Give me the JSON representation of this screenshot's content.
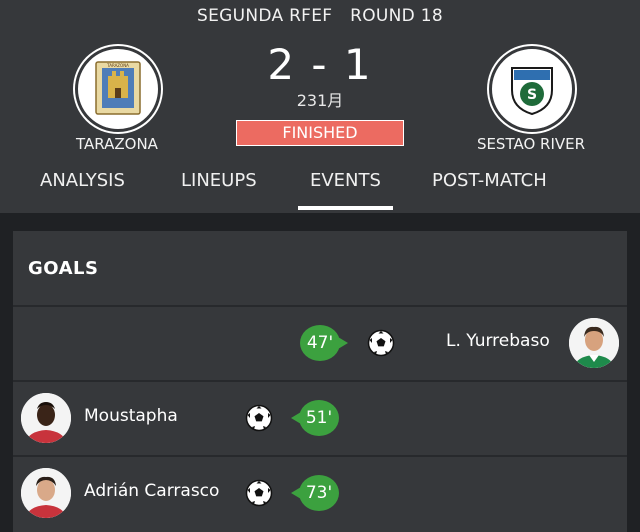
{
  "match": {
    "competition": "SEGUNDA RFEF",
    "round": "ROUND 18",
    "home_team": "TARAZONA",
    "away_team": "SESTAO RIVER",
    "score": "2 - 1",
    "date": "231月",
    "status": "FINISHED"
  },
  "tabs": [
    {
      "label": "ANALYSIS",
      "active": false
    },
    {
      "label": "LINEUPS",
      "active": false
    },
    {
      "label": "EVENTS",
      "active": true
    },
    {
      "label": "POST-MATCH",
      "active": false
    }
  ],
  "goals": {
    "title": "GOALS",
    "events": [
      {
        "player": "L. Yurrebaso",
        "minute": "47'",
        "side": "away",
        "icon": "soccer-ball-icon"
      },
      {
        "player": "Moustapha",
        "minute": "51'",
        "side": "home",
        "icon": "soccer-ball-icon"
      },
      {
        "player": "Adrián Carrasco",
        "minute": "73'",
        "side": "home",
        "icon": "soccer-ball-icon"
      }
    ]
  },
  "colors": {
    "header_bg": "#36383b",
    "page_bg": "#1f2124",
    "status_bg": "#ec6b61",
    "minute_bg": "#3ca13f"
  }
}
